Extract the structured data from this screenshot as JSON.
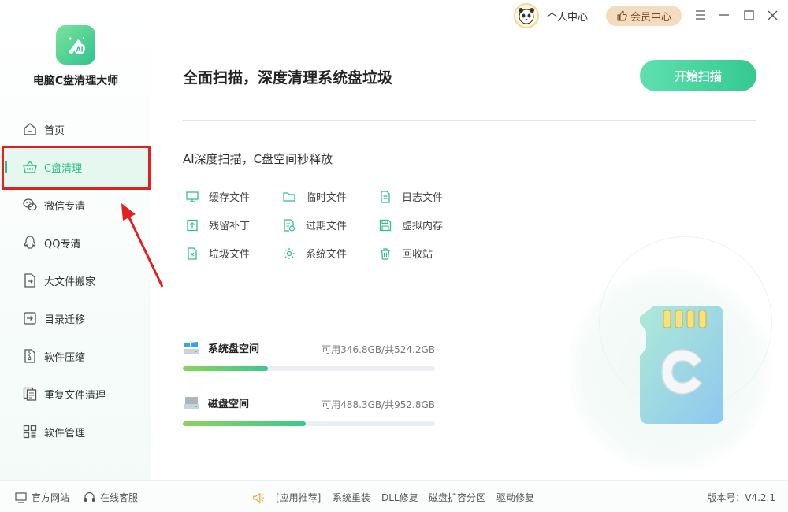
{
  "app": {
    "title": "电脑C盘清理大师"
  },
  "sidebar": {
    "items": [
      {
        "label": "首页",
        "icon": "home-icon",
        "active": false
      },
      {
        "label": "C盘清理",
        "icon": "basket-icon",
        "active": true
      },
      {
        "label": "微信专清",
        "icon": "wechat-icon",
        "active": false
      },
      {
        "label": "QQ专清",
        "icon": "qq-icon",
        "active": false
      },
      {
        "label": "大文件搬家",
        "icon": "file-move-icon",
        "active": false
      },
      {
        "label": "目录迁移",
        "icon": "folder-migrate-icon",
        "active": false
      },
      {
        "label": "软件压缩",
        "icon": "zip-icon",
        "active": false
      },
      {
        "label": "重复文件清理",
        "icon": "duplicate-icon",
        "active": false
      },
      {
        "label": "软件管理",
        "icon": "apps-icon",
        "active": false
      }
    ]
  },
  "topbar": {
    "personal": "个人中心",
    "vip": "会员中心"
  },
  "main": {
    "headline": "全面扫描，深度清理系统盘垃圾",
    "scan_button": "开始扫描",
    "subhead": "AI深度扫描，C盘空间秒释放",
    "categories": [
      {
        "label": "缓存文件",
        "icon": "monitor-icon"
      },
      {
        "label": "临时文件",
        "icon": "folder-icon"
      },
      {
        "label": "日志文件",
        "icon": "log-icon"
      },
      {
        "label": "残留补丁",
        "icon": "patch-icon"
      },
      {
        "label": "过期文件",
        "icon": "expired-file-icon"
      },
      {
        "label": "虚拟内存",
        "icon": "save-icon"
      },
      {
        "label": "垃圾文件",
        "icon": "junk-file-icon"
      },
      {
        "label": "系统文件",
        "icon": "gear-icon"
      },
      {
        "label": "回收站",
        "icon": "trash-icon"
      }
    ],
    "disks": [
      {
        "label": "系统盘空间",
        "avail": "可用346.8GB/共524.2GB",
        "used_fraction": 0.338
      },
      {
        "label": "磁盘空间",
        "avail": "可用488.3GB/共952.8GB",
        "used_fraction": 0.487
      }
    ]
  },
  "footer": {
    "official": "官方网站",
    "support": "在线客服",
    "recommend": "[应用推荐]",
    "links": [
      "系统重装",
      "DLL修复",
      "磁盘扩容分区",
      "驱动修复"
    ],
    "version": "版本号：V4.2.1"
  },
  "colors": {
    "accent": "#2fbf8f",
    "highlight": "#e41f1f"
  }
}
